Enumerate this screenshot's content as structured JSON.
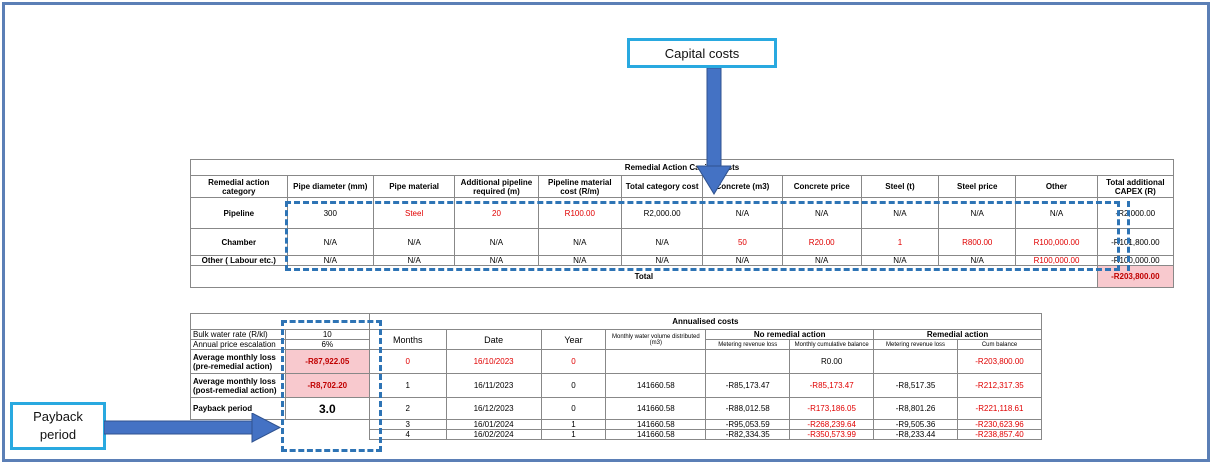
{
  "callouts": {
    "capital": "Capital costs",
    "payback": "Payback\nperiod"
  },
  "capex": {
    "title": "Remedial Action Capital costs",
    "headers": [
      "Remedial action category",
      "Pipe diameter (mm)",
      "Pipe material",
      "Additional pipeline required (m)",
      "Pipeline material cost (R/m)",
      "Total category cost",
      "Concrete (m3)",
      "Concrete price",
      "Steel (t)",
      "Steel price",
      "Other",
      "Total additional CAPEX (R)"
    ],
    "rows": [
      [
        "Pipeline",
        "300",
        "Steel",
        "20",
        "R100.00",
        "R2,000.00",
        "N/A",
        "N/A",
        "N/A",
        "N/A",
        "N/A",
        "-R2,000.00"
      ],
      [
        "Chamber",
        "N/A",
        "N/A",
        "N/A",
        "N/A",
        "N/A",
        "50",
        "R20.00",
        "1",
        "R800.00",
        "R100,000.00",
        "-R101,800.00"
      ],
      [
        "Other ( Labour etc.)",
        "N/A",
        "N/A",
        "N/A",
        "N/A",
        "N/A",
        "N/A",
        "N/A",
        "N/A",
        "N/A",
        "R100,000.00",
        "-R100,000.00"
      ]
    ],
    "total_label": "Total",
    "total_value": "-R203,800.00"
  },
  "annual": {
    "title": "Annualised costs",
    "inputs": [
      {
        "label": "Bulk water rate (R/kl)",
        "value": "10"
      },
      {
        "label": "Annual price escalation",
        "value": "6%"
      }
    ],
    "loss_pre_label": "Average monthly loss (pre-remedial action)",
    "loss_pre_value": "-R87,922.05",
    "loss_post_label": "Average monthly loss (post-remedial action)",
    "loss_post_value": "-R8,702.20",
    "payback_label": "Payback period",
    "payback_value": "3.0",
    "col_headers": [
      "Months",
      "Date",
      "Year",
      "Monthly water volume distributed (m3)"
    ],
    "group_none": "No remedial action",
    "group_remedial": "Remedial action",
    "sub_headers": [
      "Metering revenue loss",
      "Monthly cumulative balance",
      "Metering revenue loss",
      "Cum balance"
    ],
    "rows": [
      [
        "0",
        "16/10/2023",
        "0",
        "",
        "",
        "R0.00",
        "",
        "-R203,800.00"
      ],
      [
        "1",
        "16/11/2023",
        "0",
        "141660.58",
        "-R85,173.47",
        "-R85,173.47",
        "-R8,517.35",
        "-R212,317.35"
      ],
      [
        "2",
        "16/12/2023",
        "0",
        "141660.58",
        "-R88,012.58",
        "-R173,186.05",
        "-R8,801.26",
        "-R221,118.61"
      ],
      [
        "3",
        "16/01/2024",
        "1",
        "141660.58",
        "-R95,053.59",
        "-R268,239.64",
        "-R9,505.36",
        "-R230,623.96"
      ],
      [
        "4",
        "16/02/2024",
        "1",
        "141660.58",
        "-R82,334.35",
        "-R350,573.99",
        "-R8,233.44",
        "-R238,857.40"
      ]
    ]
  }
}
